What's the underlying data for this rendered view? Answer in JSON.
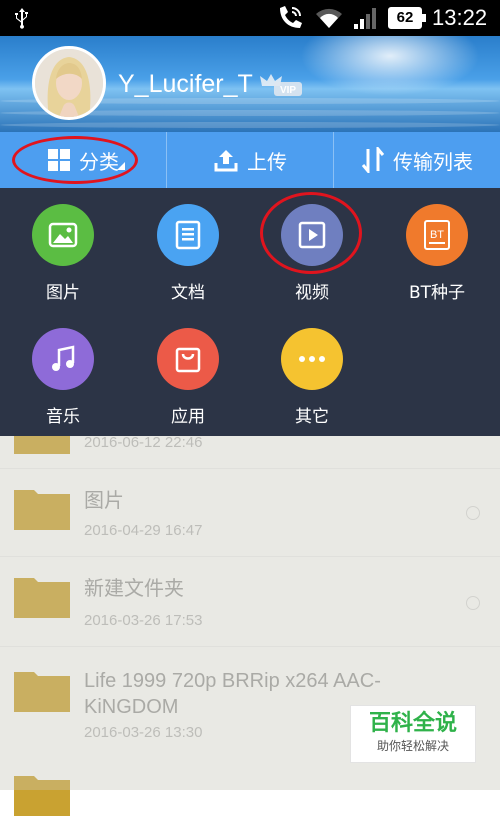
{
  "status_bar": {
    "time": "13:22",
    "battery": "62"
  },
  "profile": {
    "username": "Y_Lucifer_T",
    "badge": "VIP"
  },
  "toolbar": {
    "category_label": "分类",
    "upload_label": "上传",
    "transfer_label": "传输列表"
  },
  "categories": [
    {
      "label": "图片",
      "icon": "image-icon",
      "color": "#5bbd43"
    },
    {
      "label": "文档",
      "icon": "document-icon",
      "color": "#4aa3f2"
    },
    {
      "label": "视频",
      "icon": "video-play-icon",
      "color": "#6f7fc0"
    },
    {
      "label": "BT种子",
      "icon": "bt-torrent-icon",
      "icon_text": "BT",
      "color": "#f07a2c"
    },
    {
      "label": "音乐",
      "icon": "music-note-icon",
      "color": "#8e6bd8"
    },
    {
      "label": "应用",
      "icon": "shopping-bag-icon",
      "color": "#ec5a48"
    },
    {
      "label": "其它",
      "icon": "more-icon",
      "color": "#f5c330"
    }
  ],
  "files": [
    {
      "name": "",
      "date": "2016-06-12  22:46"
    },
    {
      "name": "图片",
      "date": "2016-04-29  16:47"
    },
    {
      "name": "新建文件夹",
      "date": "2016-03-26  17:53"
    },
    {
      "name": "Life 1999 720p  BRRip x264 AAC-KiNGDOM",
      "date": "2016-03-26  13:30"
    }
  ],
  "watermark": {
    "brand": "百科全说",
    "slogan": "助你轻松解决"
  },
  "colors": {
    "toolbar": "#4d9ef0",
    "panel": "#2c3446",
    "highlight_ring": "#e0141e",
    "folder": "#c9a231"
  }
}
